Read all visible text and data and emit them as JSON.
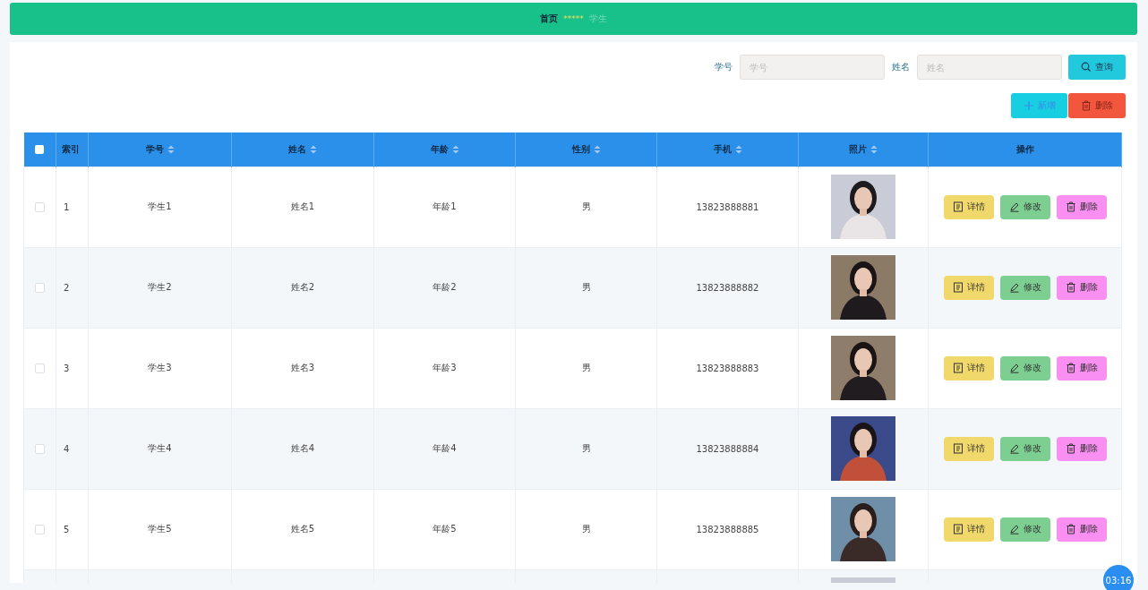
{
  "breadcrumb": [
    {
      "label": "首页",
      "kind": "current"
    },
    {
      "label": "*****",
      "kind": "separator"
    },
    {
      "label": "学生",
      "kind": "faded"
    }
  ],
  "search": {
    "fields": [
      {
        "label": "学号",
        "placeholder": "学号"
      },
      {
        "label": "姓名",
        "placeholder": "姓名"
      }
    ],
    "button": "查询"
  },
  "actions": [
    {
      "label": "新增",
      "kind": "add"
    },
    {
      "label": "删除",
      "kind": "delete"
    }
  ],
  "table": {
    "select_all": {
      "checked": false
    },
    "columns": [
      {
        "label": "索引",
        "sortable": false
      },
      {
        "label": "学号",
        "sortable": true
      },
      {
        "label": "姓名",
        "sortable": true
      },
      {
        "label": "年龄",
        "sortable": true
      },
      {
        "label": "性别",
        "sortable": true
      },
      {
        "label": "手机",
        "sortable": true
      },
      {
        "label": "照片",
        "sortable": true
      },
      {
        "label": "操作",
        "sortable": false
      }
    ],
    "rows": [
      {
        "checked": false,
        "cells": [
          "1",
          "学生1",
          "姓名1",
          "年龄1",
          "男",
          "13823888881"
        ],
        "photo": {
          "kind": "picture"
        },
        "buttons": [
          {
            "label": "详情",
            "kind": "detail"
          },
          {
            "label": "修改",
            "kind": "edit"
          },
          {
            "label": "删除",
            "kind": "delete"
          }
        ]
      },
      {
        "checked": false,
        "cells": [
          "2",
          "学生2",
          "姓名2",
          "年龄2",
          "男",
          "13823888882"
        ],
        "photo": {
          "kind": "picture"
        },
        "buttons": [
          {
            "label": "详情",
            "kind": "detail"
          },
          {
            "label": "修改",
            "kind": "edit"
          },
          {
            "label": "删除",
            "kind": "delete"
          }
        ]
      },
      {
        "checked": false,
        "cells": [
          "3",
          "学生3",
          "姓名3",
          "年龄3",
          "男",
          "13823888883"
        ],
        "photo": {
          "kind": "picture"
        },
        "buttons": [
          {
            "label": "详情",
            "kind": "detail"
          },
          {
            "label": "修改",
            "kind": "edit"
          },
          {
            "label": "删除",
            "kind": "delete"
          }
        ]
      },
      {
        "checked": false,
        "cells": [
          "4",
          "学生4",
          "姓名4",
          "年龄4",
          "男",
          "13823888884"
        ],
        "photo": {
          "kind": "picture"
        },
        "buttons": [
          {
            "label": "详情",
            "kind": "detail"
          },
          {
            "label": "修改",
            "kind": "edit"
          },
          {
            "label": "删除",
            "kind": "delete"
          }
        ]
      },
      {
        "checked": false,
        "cells": [
          "5",
          "学生5",
          "姓名5",
          "年龄5",
          "男",
          "13823888885"
        ],
        "photo": {
          "kind": "picture"
        },
        "buttons": [
          {
            "label": "详情",
            "kind": "detail"
          },
          {
            "label": "修改",
            "kind": "edit"
          },
          {
            "label": "删除",
            "kind": "delete"
          }
        ]
      },
      {
        "photo": {
          "kind": "picture"
        }
      }
    ]
  },
  "timer": "03:16"
}
